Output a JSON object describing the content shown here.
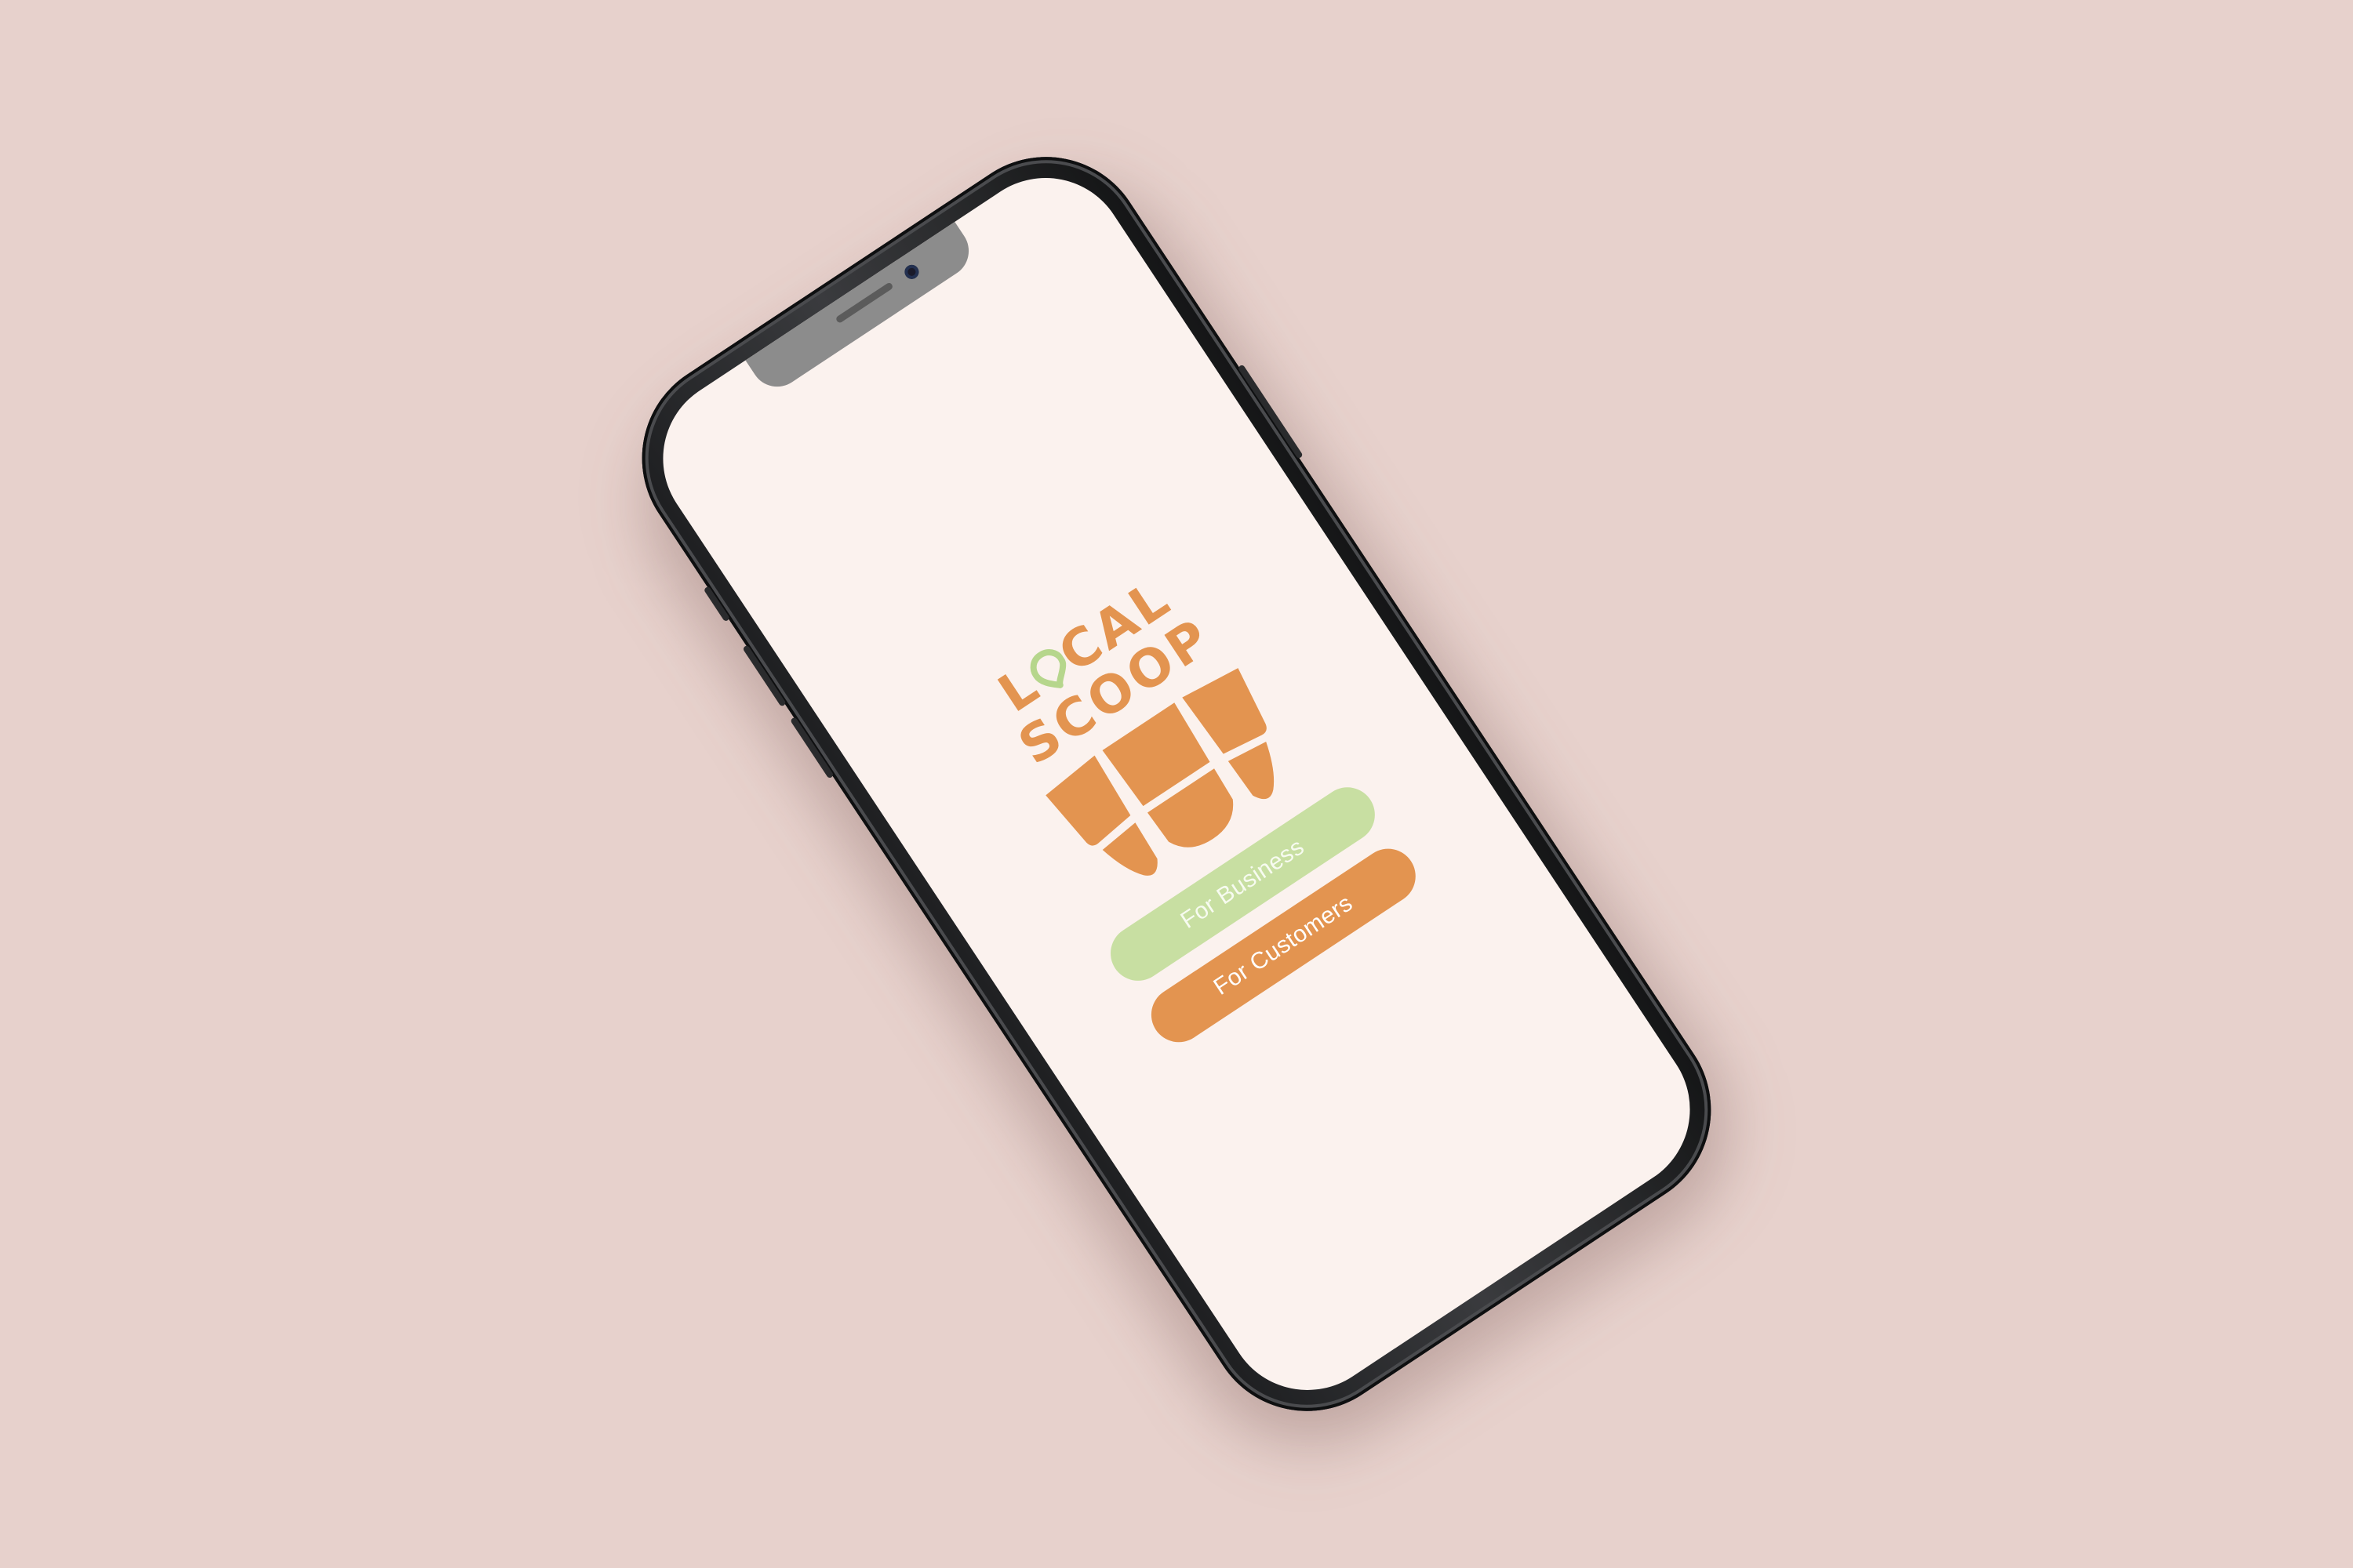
{
  "app": {
    "name_line1": "LOCAL",
    "name_line2": "SCOOP"
  },
  "buttons": {
    "business_label": "For Business",
    "customers_label": "For Customers"
  },
  "colors": {
    "background": "#e7d1cc",
    "screen": "#fbf2ee",
    "brand_orange": "#e39450",
    "brand_green": "#c8dfa2"
  },
  "icons": {
    "logo_mark": "storefront-awning-icon",
    "logo_pin": "map-pin-icon"
  }
}
